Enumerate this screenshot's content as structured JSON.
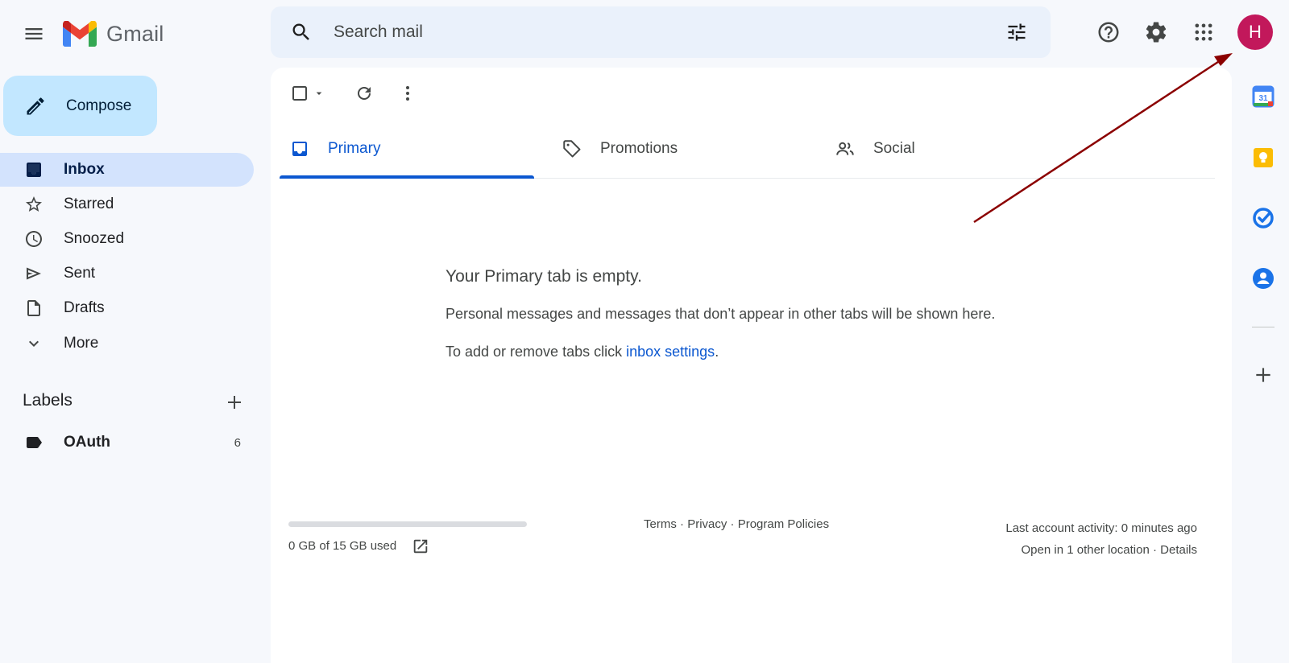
{
  "app": {
    "name": "Gmail"
  },
  "search": {
    "placeholder": "Search mail"
  },
  "account": {
    "initial": "H"
  },
  "compose": {
    "label": "Compose"
  },
  "nav": [
    {
      "label": "Inbox",
      "icon": "inbox-icon",
      "active": true
    },
    {
      "label": "Starred",
      "icon": "star-icon"
    },
    {
      "label": "Snoozed",
      "icon": "clock-icon"
    },
    {
      "label": "Sent",
      "icon": "send-icon"
    },
    {
      "label": "Drafts",
      "icon": "draft-icon"
    },
    {
      "label": "More",
      "icon": "chevron-down-icon"
    }
  ],
  "labels": {
    "title": "Labels",
    "items": [
      {
        "name": "OAuth",
        "count": "6"
      }
    ]
  },
  "tabs": [
    {
      "label": "Primary",
      "icon": "inbox-icon",
      "active": true
    },
    {
      "label": "Promotions",
      "icon": "tag-icon"
    },
    {
      "label": "Social",
      "icon": "people-icon"
    }
  ],
  "empty": {
    "title": "Your Primary tab is empty.",
    "line1": "Personal messages and messages that don’t appear in other tabs will be shown here.",
    "line2_prefix": "To add or remove tabs click ",
    "line2_link": "inbox settings",
    "line2_suffix": "."
  },
  "storage": {
    "text": "0 GB of 15 GB used",
    "used_fraction": 0
  },
  "footer": {
    "terms": "Terms",
    "privacy": "Privacy",
    "policies": "Program Policies",
    "sep": " · ",
    "activity": "Last account activity: 0 minutes ago",
    "open_other": "Open in 1 other location",
    "details": "Details"
  },
  "colors": {
    "accent": "#0b57d0",
    "compose_bg": "#c2e7ff",
    "active_nav_bg": "#d3e3fd",
    "avatar_bg": "#c2185b",
    "annotation_arrow": "#8b0000"
  }
}
